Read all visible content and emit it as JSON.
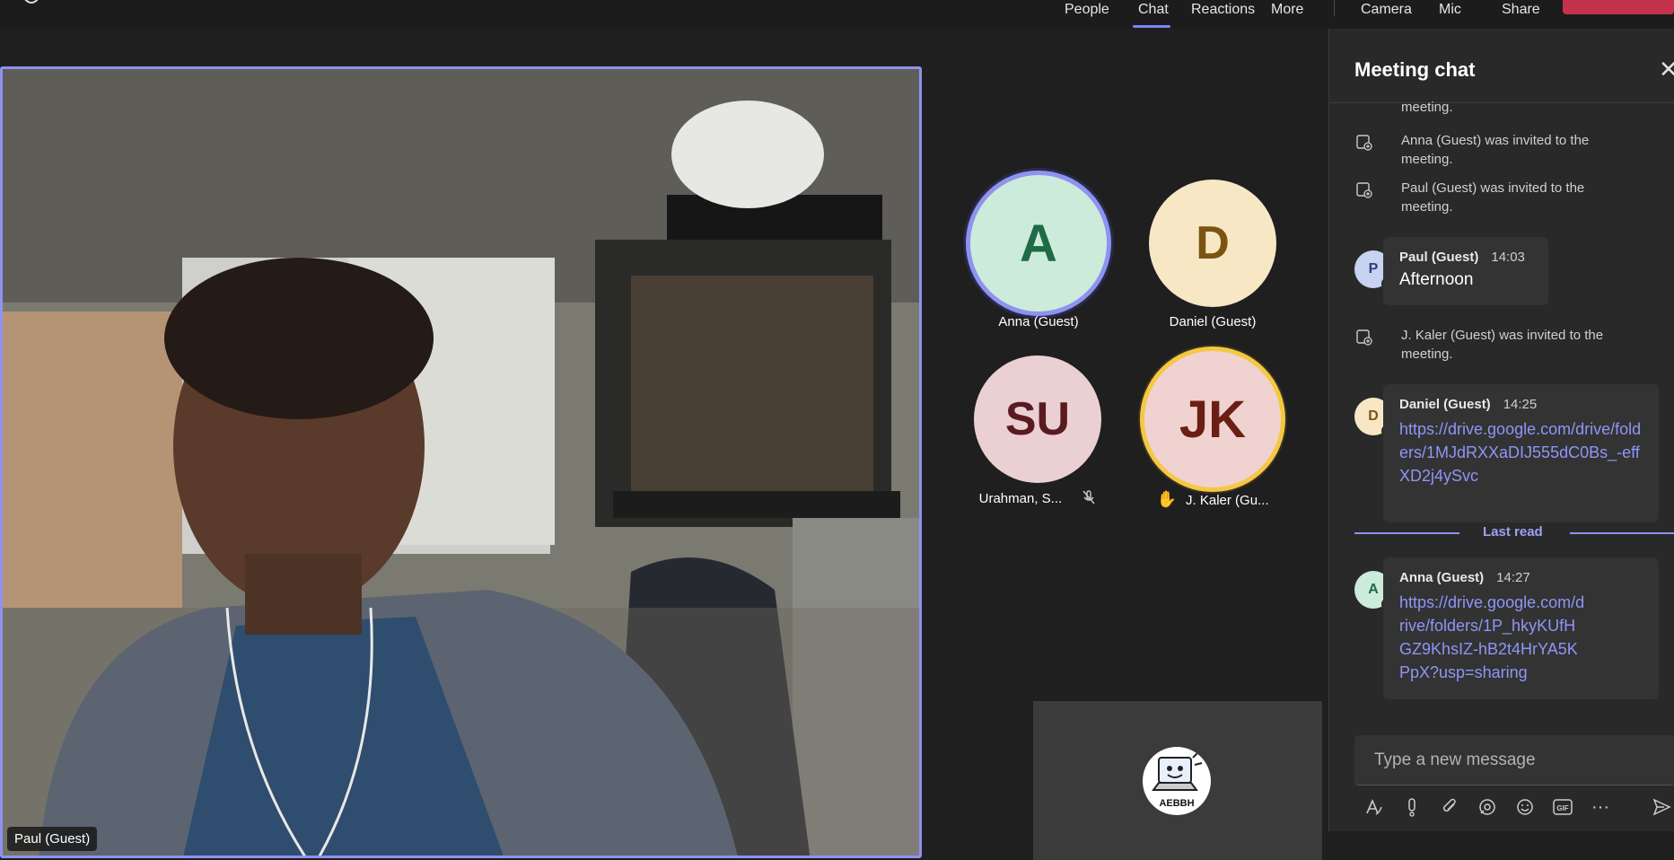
{
  "topbar": {
    "items": [
      "People",
      "Chat",
      "Reactions",
      "More"
    ],
    "actions": [
      "Camera",
      "Mic",
      "Share"
    ]
  },
  "main_video": {
    "name": "Paul (Guest)"
  },
  "tiles": [
    {
      "initials": "A",
      "label": "Anna (Guest)",
      "bg": "#cdebdb",
      "fg": "#1e6b45",
      "ring": "#8e92f0"
    },
    {
      "initials": "D",
      "label": "Daniel (Guest)",
      "bg": "#f7e7c4",
      "fg": "#7a5410",
      "ring": ""
    },
    {
      "initials": "SU",
      "label": "Urahman, S...",
      "bg": "#ebd0d3",
      "fg": "#5a1a22",
      "ring": "",
      "muted": true
    },
    {
      "initials": "JK",
      "label": "J. Kaler (Gu...",
      "bg": "#f0d2d0",
      "fg": "#6a1f14",
      "ring": "#f5c842",
      "hand_raised": true
    }
  ],
  "self_view": {
    "logo_text": "AEBBH"
  },
  "chat": {
    "title": "Meeting chat",
    "close_icon": "close-icon",
    "top_fragment": "meeting.",
    "events": [
      {
        "text": "Anna (Guest) was invited to the meeting."
      },
      {
        "text": "Paul (Guest) was invited to the meeting."
      },
      {
        "text": "J. Kaler (Guest) was invited to the meeting."
      }
    ],
    "messages": [
      {
        "initial": "P",
        "author": "Paul (Guest)",
        "time": "14:03",
        "text": "Afternoon",
        "avatar_bg": "#c7d3f0",
        "avatar_fg": "#2b3f7a"
      },
      {
        "initial": "D",
        "author": "Daniel (Guest)",
        "time": "14:25",
        "text": "https://drive.google.com/drive/folders/1MJdRXXaDIJ555dC0Bs_-effXD2j4ySvc",
        "avatar_bg": "#f7e7c4",
        "avatar_fg": "#7a5410"
      },
      {
        "initial": "A",
        "author": "Anna (Guest)",
        "time": "14:27",
        "text": "https://drive.google.com/drive/folders/1P_hkyKUfHGZ9KhsIZ-hB2t4HrYA5KPpX?usp=sharing",
        "avatar_bg": "#cdebdb",
        "avatar_fg": "#1e6b45"
      }
    ],
    "last_read_label": "Last read",
    "composer_placeholder": "Type a new message"
  }
}
